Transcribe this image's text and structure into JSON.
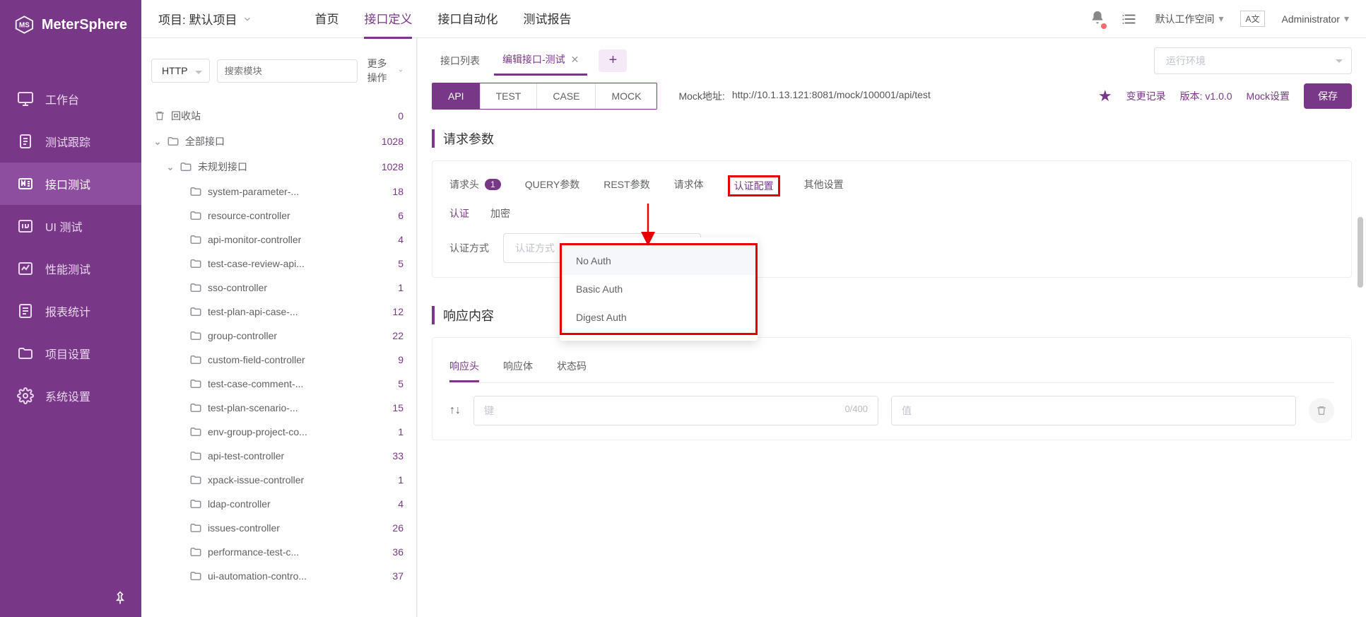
{
  "brand": "MeterSphere",
  "project_label": "项目: 默认项目",
  "top_nav": {
    "home": "首页",
    "api_def": "接口定义",
    "api_auto": "接口自动化",
    "report": "测试报告"
  },
  "workspace": "默认工作空间",
  "lang_badge": "A文",
  "user": "Administrator",
  "side_nav": {
    "workbench": "工作台",
    "track": "测试跟踪",
    "api_test": "接口测试",
    "ui_test": "UI 测试",
    "perf": "性能测试",
    "report": "报表统计",
    "proj_set": "项目设置",
    "sys_set": "系统设置"
  },
  "tree_toolbar": {
    "protocol": "HTTP",
    "search_placeholder": "搜索模块",
    "more": "更多操作"
  },
  "tree": {
    "recycle": {
      "label": "回收站",
      "count": "0"
    },
    "root": {
      "label": "全部接口",
      "count": "1028"
    },
    "unplanned": {
      "label": "未规划接口",
      "count": "1028"
    },
    "items": [
      {
        "label": "system-parameter-...",
        "count": "18"
      },
      {
        "label": "resource-controller",
        "count": "6"
      },
      {
        "label": "api-monitor-controller",
        "count": "4"
      },
      {
        "label": "test-case-review-api...",
        "count": "5"
      },
      {
        "label": "sso-controller",
        "count": "1"
      },
      {
        "label": "test-plan-api-case-...",
        "count": "12"
      },
      {
        "label": "group-controller",
        "count": "22"
      },
      {
        "label": "custom-field-controller",
        "count": "9"
      },
      {
        "label": "test-case-comment-...",
        "count": "5"
      },
      {
        "label": "test-plan-scenario-...",
        "count": "15"
      },
      {
        "label": "env-group-project-co...",
        "count": "1"
      },
      {
        "label": "api-test-controller",
        "count": "33"
      },
      {
        "label": "xpack-issue-controller",
        "count": "1"
      },
      {
        "label": "ldap-controller",
        "count": "4"
      },
      {
        "label": "issues-controller",
        "count": "26"
      },
      {
        "label": "performance-test-c...",
        "count": "36"
      },
      {
        "label": "ui-automation-contro...",
        "count": "37"
      }
    ]
  },
  "tabs": {
    "list": "接口列表",
    "edit": "编辑接口-测试"
  },
  "run_env_placeholder": "运行环境",
  "api_subtabs": {
    "api": "API",
    "test": "TEST",
    "case": "CASE",
    "mock": "MOCK"
  },
  "mock_label": "Mock地址:",
  "mock_url": "http://10.1.13.121:8081/mock/100001/api/test",
  "changelog": "变更记录",
  "version": "版本: v1.0.0",
  "mock_setting": "Mock设置",
  "save": "保存",
  "section_request": "请求参数",
  "param_tabs": {
    "headers": "请求头",
    "headers_badge": "1",
    "query": "QUERY参数",
    "rest": "REST参数",
    "body": "请求体",
    "auth": "认证配置",
    "other": "其他设置"
  },
  "auth_sub": {
    "auth": "认证",
    "encrypt": "加密"
  },
  "auth_method_label": "认证方式",
  "auth_select_placeholder": "认证方式",
  "auth_options": {
    "none": "No Auth",
    "basic": "Basic Auth",
    "digest": "Digest Auth"
  },
  "section_response": "响应内容",
  "resp_tabs": {
    "headers": "响应头",
    "body": "响应体",
    "status": "状态码"
  },
  "kv": {
    "key_placeholder": "键",
    "key_counter": "0/400",
    "val_placeholder": "值"
  }
}
